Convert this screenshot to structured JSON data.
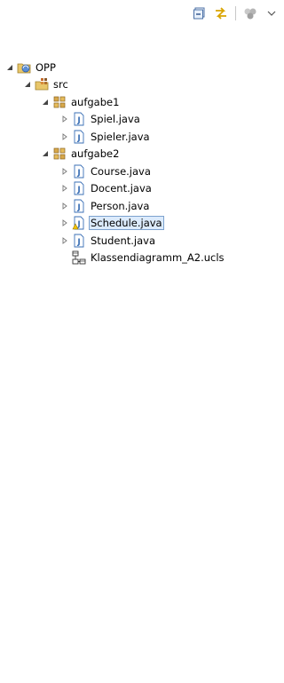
{
  "toolbar": {
    "collapse_all": "collapse-all-icon",
    "link_editor": "link-with-editor-icon",
    "focus": "focus-icon",
    "view_menu": "view-menu-icon"
  },
  "tree": {
    "project": "OPP",
    "src": "src",
    "pkg1": "aufgabe1",
    "pkg1_files": [
      "Spiel.java",
      "Spieler.java"
    ],
    "pkg2": "aufgabe2",
    "pkg2_files": [
      "Course.java",
      "Docent.java",
      "Person.java",
      "Schedule.java",
      "Student.java"
    ],
    "diagram": "Klassendiagramm_A2.ucls"
  },
  "colors": {
    "java_icon": "#3a6fb5",
    "package_icon": "#c8a040",
    "selection_bg": "#dcebfc",
    "selection_border": "#7da2ce"
  }
}
